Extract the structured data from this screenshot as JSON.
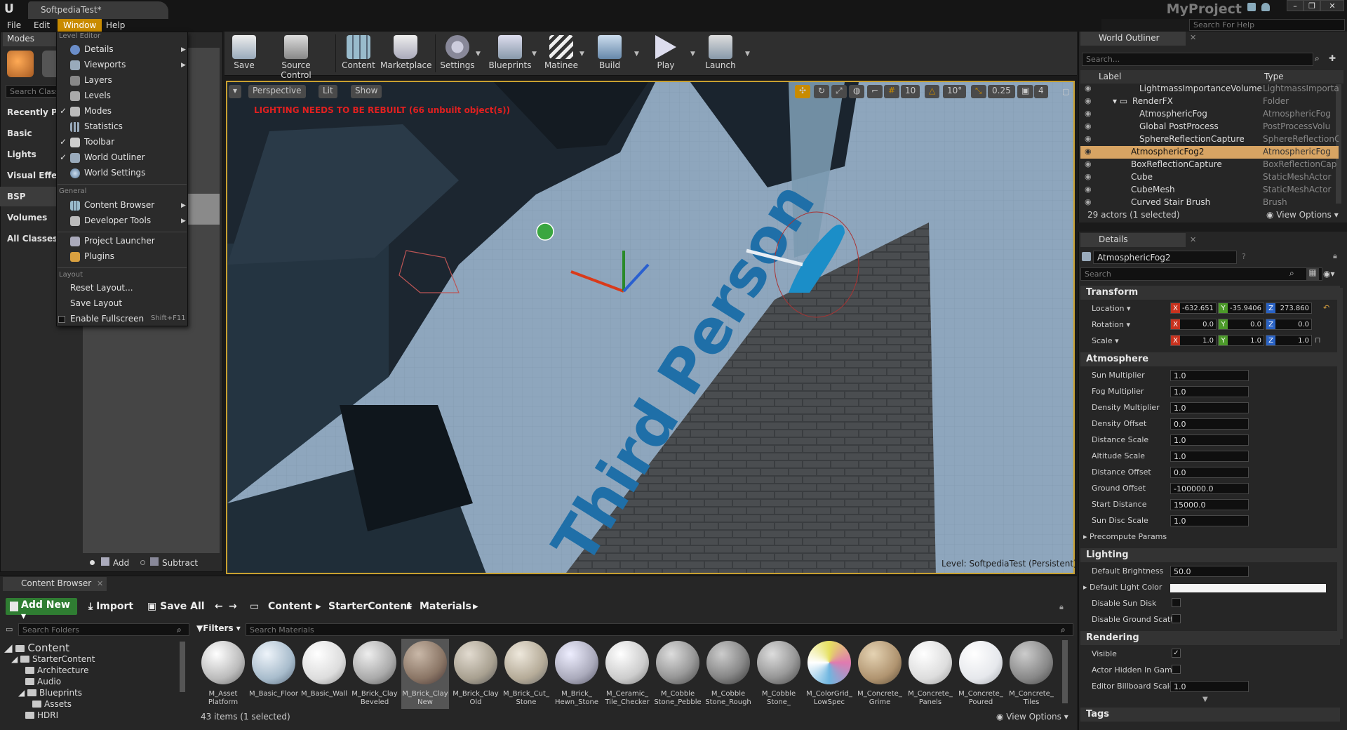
{
  "app": {
    "tab_title": "SoftpediaTest*",
    "project": "MyProject",
    "help_placeholder": "Search For Help"
  },
  "menubar": [
    "File",
    "Edit",
    "Window",
    "Help"
  ],
  "modes": {
    "tab": "Modes",
    "search_placeholder": "Search Class",
    "categories": [
      "Recently Pla",
      "Basic",
      "Lights",
      "Visual Effec",
      "BSP",
      "Volumes",
      "All Classes"
    ],
    "add": "Add",
    "subtract": "Subtract"
  },
  "window_menu": {
    "level_editor": "Level Editor",
    "items": [
      "Details",
      "Viewports",
      "Layers",
      "Levels",
      "Modes",
      "Statistics",
      "Toolbar",
      "World Outliner",
      "World Settings"
    ],
    "general": "General",
    "general_items": [
      "Content Browser",
      "Developer Tools",
      "Project Launcher",
      "Plugins"
    ],
    "layout": "Layout",
    "layout_items": [
      "Reset Layout...",
      "Save Layout",
      "Enable Fullscreen"
    ],
    "fullscreen_shortcut": "Shift+F11"
  },
  "toolbar": [
    "Save",
    "Source Control",
    "Content",
    "Marketplace",
    "Settings",
    "Blueprints",
    "Matinee",
    "Build",
    "Play",
    "Launch"
  ],
  "viewport": {
    "perspective": "Perspective",
    "lit": "Lit",
    "show": "Show",
    "warning": "LIGHTING NEEDS TO BE REBUILT (66 unbuilt object(s))",
    "grid": "10",
    "angle": "10°",
    "scale": "0.25",
    "cam_speed": "4",
    "floor_text": "Third Person",
    "level_prefix": "Level:",
    "level_name": "SoftpediaTest (Persistent)"
  },
  "outliner": {
    "tab": "World Outliner",
    "search_placeholder": "Search...",
    "col_label": "Label",
    "col_type": "Type",
    "rows": [
      {
        "label": "LightmassImportanceVolume",
        "type": "LightmassImporta"
      },
      {
        "label": "RenderFX",
        "type": "Folder"
      },
      {
        "label": "AtmosphericFog",
        "type": "AtmosphericFog"
      },
      {
        "label": "Global PostProcess",
        "type": "PostProcessVolu"
      },
      {
        "label": "SphereReflectionCapture",
        "type": "SphereReflectionC"
      },
      {
        "label": "AtmosphericFog2",
        "type": "AtmosphericFog"
      },
      {
        "label": "BoxReflectionCapture",
        "type": "BoxReflectionCap"
      },
      {
        "label": "Cube",
        "type": "StaticMeshActor"
      },
      {
        "label": "CubeMesh",
        "type": "StaticMeshActor"
      },
      {
        "label": "Curved Stair Brush",
        "type": "Brush"
      }
    ],
    "status": "29 actors (1 selected)",
    "view_options": "View Options"
  },
  "details": {
    "tab": "Details",
    "actor_name": "AtmosphericFog2",
    "search_placeholder": "Search",
    "transform": "Transform",
    "location_label": "Location",
    "rotation_label": "Rotation",
    "scale_label": "Scale",
    "location": [
      "-632.651",
      "-35.9406",
      "273.860"
    ],
    "rotation": [
      "0.0",
      "0.0",
      "0.0"
    ],
    "scale": [
      "1.0",
      "1.0",
      "1.0"
    ],
    "atmosphere": "Atmosphere",
    "atmo_props": [
      {
        "label": "Sun Multiplier",
        "value": "1.0"
      },
      {
        "label": "Fog Multiplier",
        "value": "1.0"
      },
      {
        "label": "Density Multiplier",
        "value": "1.0"
      },
      {
        "label": "Density Offset",
        "value": "0.0"
      },
      {
        "label": "Distance Scale",
        "value": "1.0"
      },
      {
        "label": "Altitude Scale",
        "value": "1.0"
      },
      {
        "label": "Distance Offset",
        "value": "0.0"
      },
      {
        "label": "Ground Offset",
        "value": "-100000.0"
      },
      {
        "label": "Start Distance",
        "value": "15000.0"
      },
      {
        "label": "Sun Disc Scale",
        "value": "1.0"
      }
    ],
    "precompute": "Precompute Params",
    "lighting": "Lighting",
    "default_brightness_label": "Default Brightness",
    "default_brightness": "50.0",
    "default_light_color": "Default Light Color",
    "disable_sun_disk": "Disable Sun Disk",
    "disable_ground": "Disable Ground Scatte",
    "rendering": "Rendering",
    "visible": "Visible",
    "actor_hidden": "Actor Hidden In Game",
    "billboard_label": "Editor Billboard Scale",
    "billboard": "1.0",
    "tags": "Tags"
  },
  "content_browser": {
    "tab": "Content Browser",
    "add_new": "Add New",
    "import": "Import",
    "save_all": "Save All",
    "crumbs": [
      "Content",
      "StarterContent",
      "Materials"
    ],
    "folder_search": "Search Folders",
    "tree": [
      "Content",
      "StarterContent",
      "Architecture",
      "Audio",
      "Blueprints",
      "Assets",
      "HDRI"
    ],
    "filters": "Filters",
    "asset_search": "Search Materials",
    "assets": [
      "M_Asset Platform",
      "M_Basic_Floor",
      "M_Basic_Wall",
      "M_Brick_Clay Beveled",
      "M_Brick_Clay New",
      "M_Brick_Clay Old",
      "M_Brick_Cut_ Stone",
      "M_Brick_ Hewn_Stone",
      "M_Ceramic_ Tile_Checker",
      "M_Cobble Stone_Pebble",
      "M_Cobble Stone_Rough",
      "M_Cobble Stone_",
      "M_ColorGrid_ LowSpec",
      "M_Concrete_ Grime",
      "M_Concrete_ Panels",
      "M_Concrete_ Poured",
      "M_Concrete_ Tiles"
    ],
    "status": "43 items (1 selected)",
    "view_options": "View Options"
  },
  "colors": {
    "accent": "#d7a463",
    "menu_highlight": "#c98b00",
    "add_new": "#2f7d32",
    "warning": "#e02020"
  }
}
